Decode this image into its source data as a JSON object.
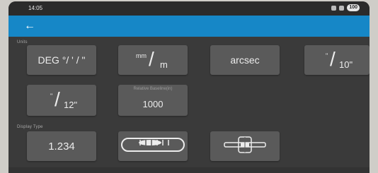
{
  "status": {
    "time": "14:05",
    "battery": "100"
  },
  "units": {
    "label": "Units",
    "deg_label": "DEG °/ ' / \"",
    "mm_num": "mm",
    "mm_den": "m",
    "arcsec_label": "arcsec",
    "ten_num": "\"",
    "ten_den": "10\"",
    "twelve_num": "\"",
    "twelve_den": "12\"",
    "baseline_label": "Relative Baseline(in)",
    "baseline_value": "1000"
  },
  "display_type": {
    "label": "Display Type",
    "numeric_value": "1.234",
    "vial_icon": "tube-vial-icon",
    "bullseye_icon": "bullseye-icon"
  },
  "colors": {
    "appbar": "#1687c7",
    "button": "#5a5a5a",
    "background": "#3a3a3a"
  }
}
